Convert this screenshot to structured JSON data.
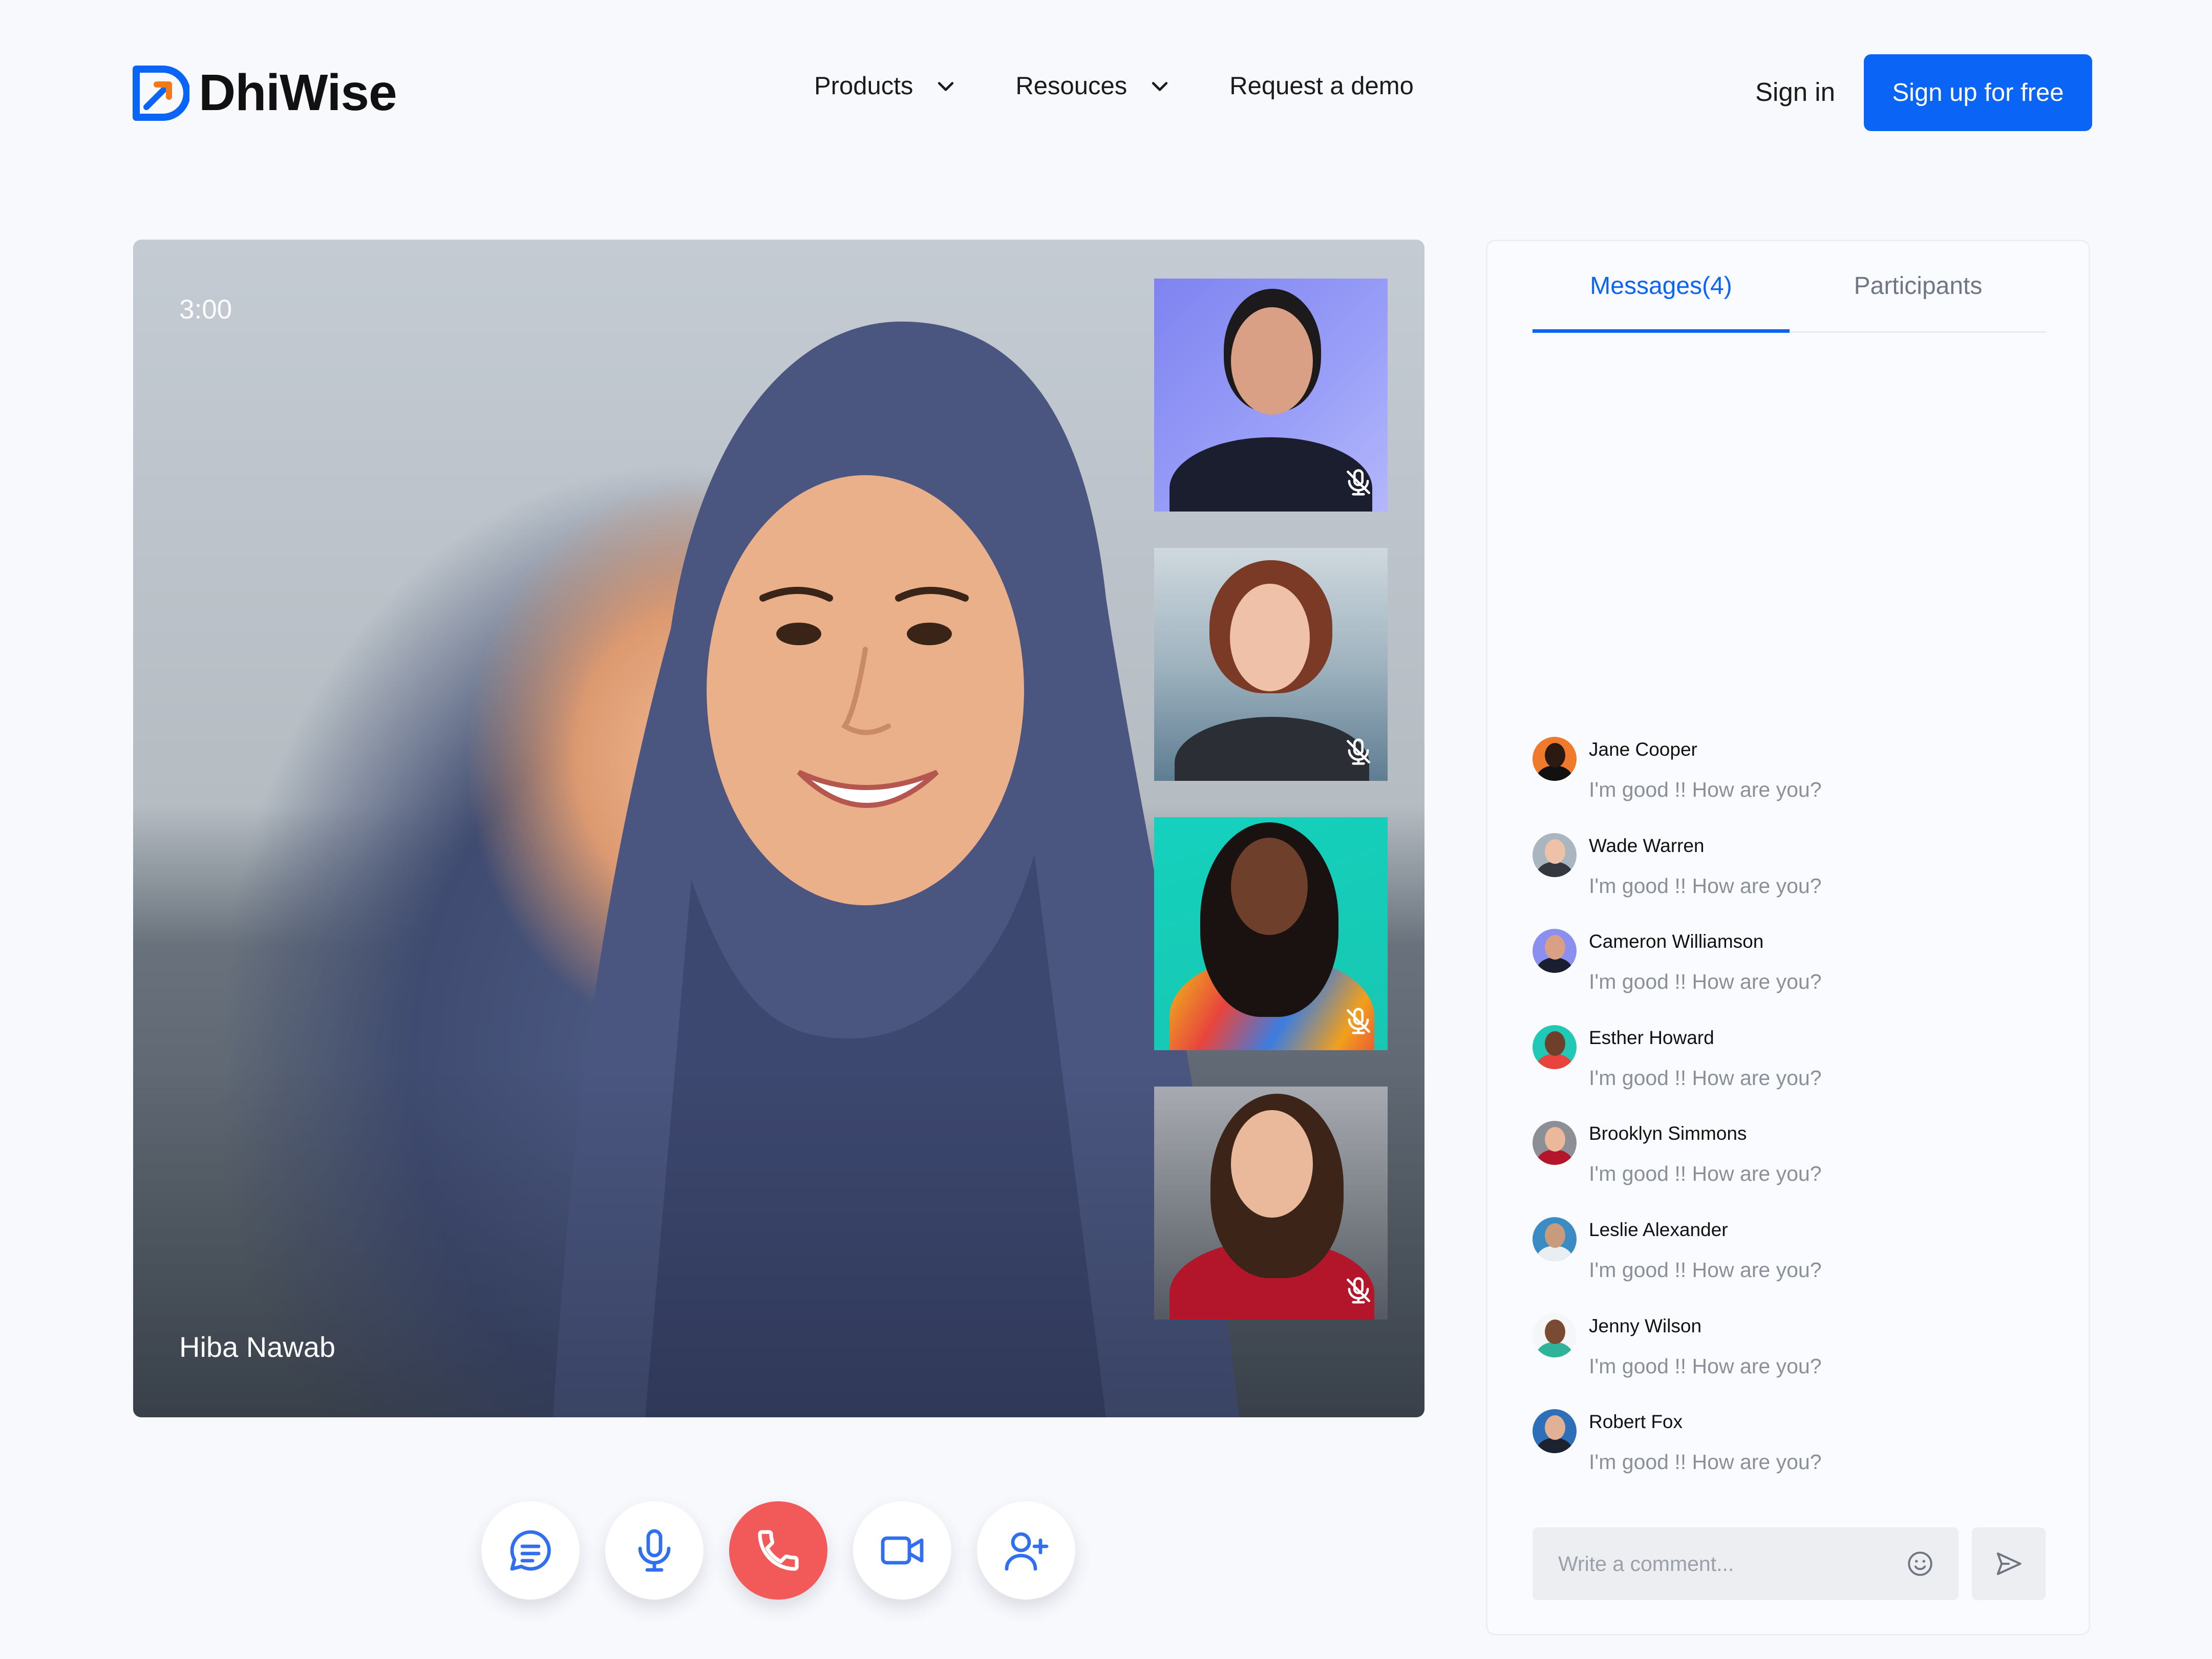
{
  "header": {
    "brand": "DhiWise",
    "nav": [
      {
        "label": "Products",
        "has_dropdown": true
      },
      {
        "label": "Resouces",
        "has_dropdown": true
      },
      {
        "label": "Request a demo",
        "has_dropdown": false
      }
    ],
    "sign_in": "Sign in",
    "sign_up": "Sign up for free"
  },
  "call": {
    "timer": "3:00",
    "speaker_name": "Hiba Nawab",
    "participants_muted": [
      true,
      true,
      true,
      true
    ],
    "controls": [
      "chat-icon",
      "microphone-icon",
      "end-call-icon",
      "video-camera-icon",
      "add-user-icon"
    ]
  },
  "chat": {
    "tabs": [
      {
        "label": "Messages(4)",
        "active": true
      },
      {
        "label": "Participants",
        "active": false
      }
    ],
    "messages": [
      {
        "name": "Jane Cooper",
        "text": "I'm good !! How are you?"
      },
      {
        "name": "Wade Warren",
        "text": "I'm good !! How are you?"
      },
      {
        "name": "Cameron Williamson",
        "text": "I'm good !! How are you?"
      },
      {
        "name": "Esther Howard",
        "text": "I'm good !! How are you?"
      },
      {
        "name": "Brooklyn Simmons",
        "text": "I'm good !! How are you?"
      },
      {
        "name": "Leslie Alexander",
        "text": "I'm good !! How are you?"
      },
      {
        "name": "Jenny Wilson",
        "text": "I'm good !! How are you?"
      },
      {
        "name": "Robert Fox",
        "text": "I'm good !! How are you?"
      }
    ],
    "comment_placeholder": "Write a comment..."
  },
  "colors": {
    "accent": "#0a64f5",
    "end_call": "#f25a5a",
    "muted_text": "#8a8f99",
    "background": "#f8f9fd"
  }
}
